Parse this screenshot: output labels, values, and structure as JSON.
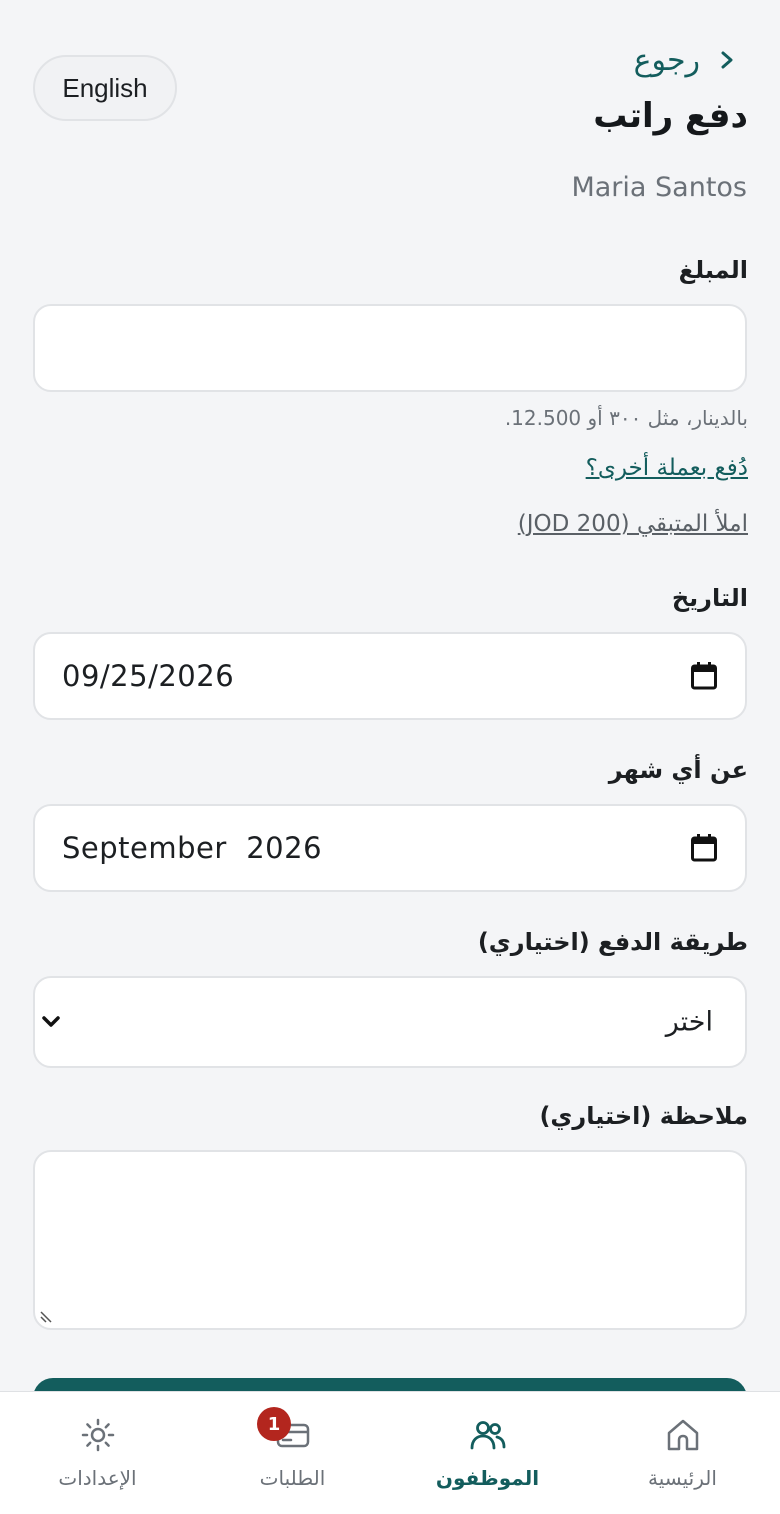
{
  "header": {
    "language_button": "English",
    "back_label": "رجوع",
    "title": "دفع راتب",
    "employee_name": "Maria Santos"
  },
  "form": {
    "amount": {
      "label": "المبلغ",
      "value": "",
      "hint": "بالدينار، مثل ٣٠٠ أو 12.500.",
      "other_currency_link": "دُفع بعملة أخرى؟",
      "fill_remaining_link": "املأ المتبقي (JOD 200)"
    },
    "date": {
      "label": "التاريخ",
      "value": "09/25/2026"
    },
    "month": {
      "label": "عن أي شهر",
      "value": "September  2026"
    },
    "payment_method": {
      "label": "طريقة الدفع (اختياري)",
      "selected": "اختر"
    },
    "note": {
      "label": "ملاحظة (اختياري)",
      "value": ""
    }
  },
  "bottom_nav": {
    "items": [
      {
        "label": "الإعدادات",
        "icon": "gear-icon"
      },
      {
        "label": "الطلبات",
        "icon": "card-icon",
        "badge": "1"
      },
      {
        "label": "الموظفون",
        "icon": "people-icon",
        "active": true
      },
      {
        "label": "الرئيسية",
        "icon": "home-icon"
      }
    ]
  },
  "colors": {
    "accent": "#135d5d",
    "background": "#f4f5f7",
    "badge": "#b3261e"
  }
}
